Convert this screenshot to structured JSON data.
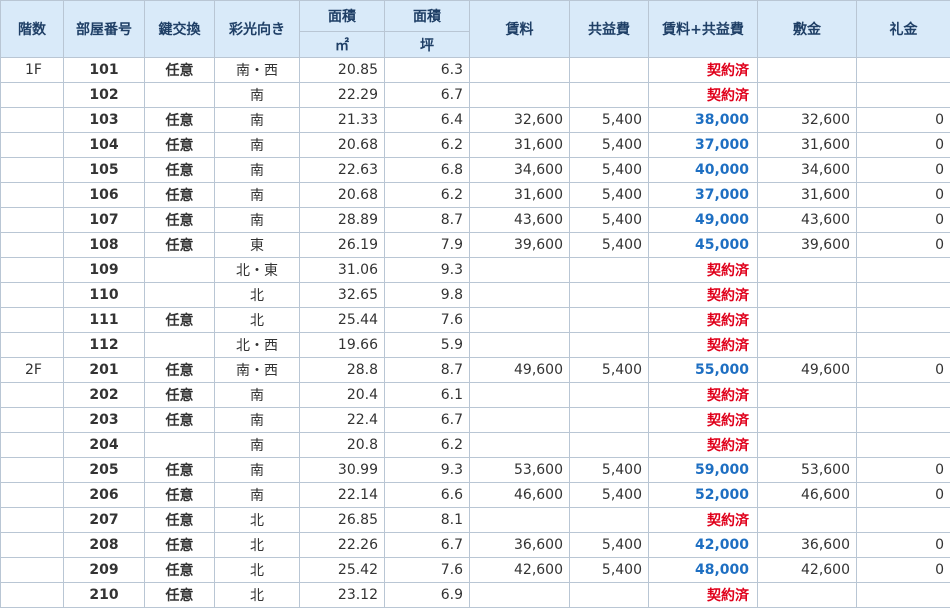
{
  "headers": {
    "floor": "階数",
    "room": "部屋番号",
    "key": "鍵交換",
    "light": "彩光向き",
    "area": "面積",
    "area_unit_m2": "㎡",
    "area_unit_tsubo": "坪",
    "rent": "賃料",
    "common": "共益費",
    "total": "賃料+共益費",
    "deposit": "敷金",
    "key_money": "礼金"
  },
  "rows": [
    {
      "floor": "1F",
      "room": "101",
      "key": "任意",
      "light": "南・西",
      "m2": "20.85",
      "tsubo": "6.3",
      "rent": "",
      "common": "",
      "total": "契約済",
      "deposit": "",
      "key_money": "",
      "sold": true
    },
    {
      "floor": "",
      "room": "102",
      "key": "",
      "light": "南",
      "m2": "22.29",
      "tsubo": "6.7",
      "rent": "",
      "common": "",
      "total": "契約済",
      "deposit": "",
      "key_money": "",
      "sold": true
    },
    {
      "floor": "",
      "room": "103",
      "key": "任意",
      "light": "南",
      "m2": "21.33",
      "tsubo": "6.4",
      "rent": "32,600",
      "common": "5,400",
      "total": "38,000",
      "deposit": "32,600",
      "key_money": "0",
      "sold": false
    },
    {
      "floor": "",
      "room": "104",
      "key": "任意",
      "light": "南",
      "m2": "20.68",
      "tsubo": "6.2",
      "rent": "31,600",
      "common": "5,400",
      "total": "37,000",
      "deposit": "31,600",
      "key_money": "0",
      "sold": false
    },
    {
      "floor": "",
      "room": "105",
      "key": "任意",
      "light": "南",
      "m2": "22.63",
      "tsubo": "6.8",
      "rent": "34,600",
      "common": "5,400",
      "total": "40,000",
      "deposit": "34,600",
      "key_money": "0",
      "sold": false
    },
    {
      "floor": "",
      "room": "106",
      "key": "任意",
      "light": "南",
      "m2": "20.68",
      "tsubo": "6.2",
      "rent": "31,600",
      "common": "5,400",
      "total": "37,000",
      "deposit": "31,600",
      "key_money": "0",
      "sold": false
    },
    {
      "floor": "",
      "room": "107",
      "key": "任意",
      "light": "南",
      "m2": "28.89",
      "tsubo": "8.7",
      "rent": "43,600",
      "common": "5,400",
      "total": "49,000",
      "deposit": "43,600",
      "key_money": "0",
      "sold": false
    },
    {
      "floor": "",
      "room": "108",
      "key": "任意",
      "light": "東",
      "m2": "26.19",
      "tsubo": "7.9",
      "rent": "39,600",
      "common": "5,400",
      "total": "45,000",
      "deposit": "39,600",
      "key_money": "0",
      "sold": false
    },
    {
      "floor": "",
      "room": "109",
      "key": "",
      "light": "北・東",
      "m2": "31.06",
      "tsubo": "9.3",
      "rent": "",
      "common": "",
      "total": "契約済",
      "deposit": "",
      "key_money": "",
      "sold": true
    },
    {
      "floor": "",
      "room": "110",
      "key": "",
      "light": "北",
      "m2": "32.65",
      "tsubo": "9.8",
      "rent": "",
      "common": "",
      "total": "契約済",
      "deposit": "",
      "key_money": "",
      "sold": true
    },
    {
      "floor": "",
      "room": "111",
      "key": "任意",
      "light": "北",
      "m2": "25.44",
      "tsubo": "7.6",
      "rent": "",
      "common": "",
      "total": "契約済",
      "deposit": "",
      "key_money": "",
      "sold": true
    },
    {
      "floor": "",
      "room": "112",
      "key": "",
      "light": "北・西",
      "m2": "19.66",
      "tsubo": "5.9",
      "rent": "",
      "common": "",
      "total": "契約済",
      "deposit": "",
      "key_money": "",
      "sold": true
    },
    {
      "floor": "2F",
      "room": "201",
      "key": "任意",
      "light": "南・西",
      "m2": "28.8",
      "tsubo": "8.7",
      "rent": "49,600",
      "common": "5,400",
      "total": "55,000",
      "deposit": "49,600",
      "key_money": "0",
      "sold": false
    },
    {
      "floor": "",
      "room": "202",
      "key": "任意",
      "light": "南",
      "m2": "20.4",
      "tsubo": "6.1",
      "rent": "",
      "common": "",
      "total": "契約済",
      "deposit": "",
      "key_money": "",
      "sold": true
    },
    {
      "floor": "",
      "room": "203",
      "key": "任意",
      "light": "南",
      "m2": "22.4",
      "tsubo": "6.7",
      "rent": "",
      "common": "",
      "total": "契約済",
      "deposit": "",
      "key_money": "",
      "sold": true
    },
    {
      "floor": "",
      "room": "204",
      "key": "",
      "light": "南",
      "m2": "20.8",
      "tsubo": "6.2",
      "rent": "",
      "common": "",
      "total": "契約済",
      "deposit": "",
      "key_money": "",
      "sold": true
    },
    {
      "floor": "",
      "room": "205",
      "key": "任意",
      "light": "南",
      "m2": "30.99",
      "tsubo": "9.3",
      "rent": "53,600",
      "common": "5,400",
      "total": "59,000",
      "deposit": "53,600",
      "key_money": "0",
      "sold": false
    },
    {
      "floor": "",
      "room": "206",
      "key": "任意",
      "light": "南",
      "m2": "22.14",
      "tsubo": "6.6",
      "rent": "46,600",
      "common": "5,400",
      "total": "52,000",
      "deposit": "46,600",
      "key_money": "0",
      "sold": false
    },
    {
      "floor": "",
      "room": "207",
      "key": "任意",
      "light": "北",
      "m2": "26.85",
      "tsubo": "8.1",
      "rent": "",
      "common": "",
      "total": "契約済",
      "deposit": "",
      "key_money": "",
      "sold": true
    },
    {
      "floor": "",
      "room": "208",
      "key": "任意",
      "light": "北",
      "m2": "22.26",
      "tsubo": "6.7",
      "rent": "36,600",
      "common": "5,400",
      "total": "42,000",
      "deposit": "36,600",
      "key_money": "0",
      "sold": false
    },
    {
      "floor": "",
      "room": "209",
      "key": "任意",
      "light": "北",
      "m2": "25.42",
      "tsubo": "7.6",
      "rent": "42,600",
      "common": "5,400",
      "total": "48,000",
      "deposit": "42,600",
      "key_money": "0",
      "sold": false
    },
    {
      "floor": "",
      "room": "210",
      "key": "任意",
      "light": "北",
      "m2": "23.12",
      "tsubo": "6.9",
      "rent": "",
      "common": "",
      "total": "契約済",
      "deposit": "",
      "key_money": "",
      "sold": true
    }
  ],
  "colors": {
    "header_bg": "#d9eaf9",
    "border": "#b9c6d4",
    "available_total": "#1e6fc2",
    "sold_total": "#e0001b"
  }
}
